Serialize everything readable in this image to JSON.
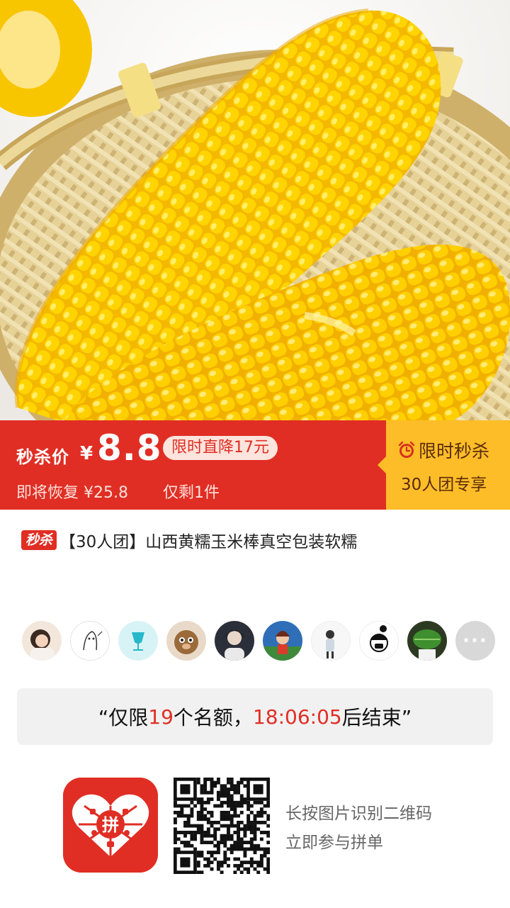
{
  "banner": {
    "price_label": "秒杀价",
    "currency": "¥",
    "price": "8.8",
    "drop_badge": "限时直降17元",
    "restore_text": "即将恢复 ¥25.8",
    "remain_text": "仅剩1件",
    "flash_title": "限时秒杀",
    "flash_sub": "30人团专享"
  },
  "product": {
    "tag": "秒杀",
    "title": "【30人团】山西黄糯玉米棒真空包装软糯"
  },
  "avatars": {
    "more_label": "···"
  },
  "quota": {
    "prefix": "“仅限",
    "count": "19",
    "middle": "个名额，",
    "time": "18:06:05",
    "suffix": "后结束”"
  },
  "footer": {
    "logo_char": "拼",
    "line1": "长按图片识别二维码",
    "line2": "立即参与拼单"
  },
  "colors": {
    "brand_red": "#e02e24",
    "flash_yellow": "#fdbd28",
    "corn_yellow": "#f7c600"
  },
  "icons": {
    "clock": "alarm-clock-icon",
    "more": "more-dots-icon"
  }
}
